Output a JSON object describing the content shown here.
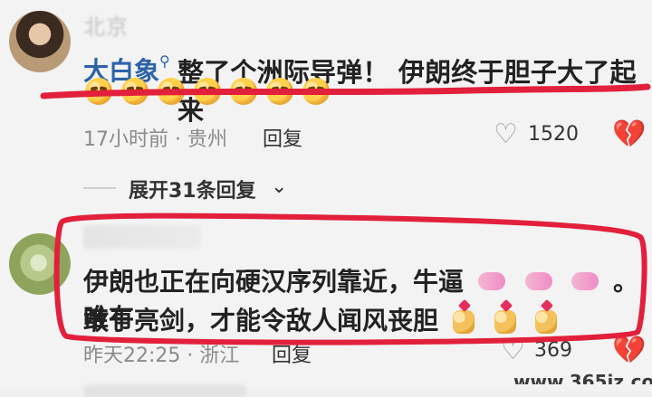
{
  "comment1": {
    "author_handle": "大白象",
    "author_icon": "search-icon",
    "author_top_name": "北京",
    "text": "整了个洲际导弹！ 伊朗终于胆子大了起来",
    "emoji_count": 7,
    "meta": "17小时前 · 贵州",
    "reply_label": "回复",
    "like_count": "1520"
  },
  "thread": {
    "expand_label": "展开31条回复"
  },
  "comment2": {
    "line1": "伊朗也正在向硬汉序列靠近，牛逼",
    "line1_tail": "。唯有",
    "line2": "敢于亮剑，才能令敌人闻风丧胆",
    "meta": "昨天22:25 · 浙江",
    "reply_label": "回复",
    "like_count": "369"
  },
  "watermark": "www.365jz.com",
  "colors": {
    "annotation_red": "#e2203b",
    "link_blue": "#2c63a8",
    "text_dark": "#222222",
    "text_muted": "#8a8a8a"
  }
}
